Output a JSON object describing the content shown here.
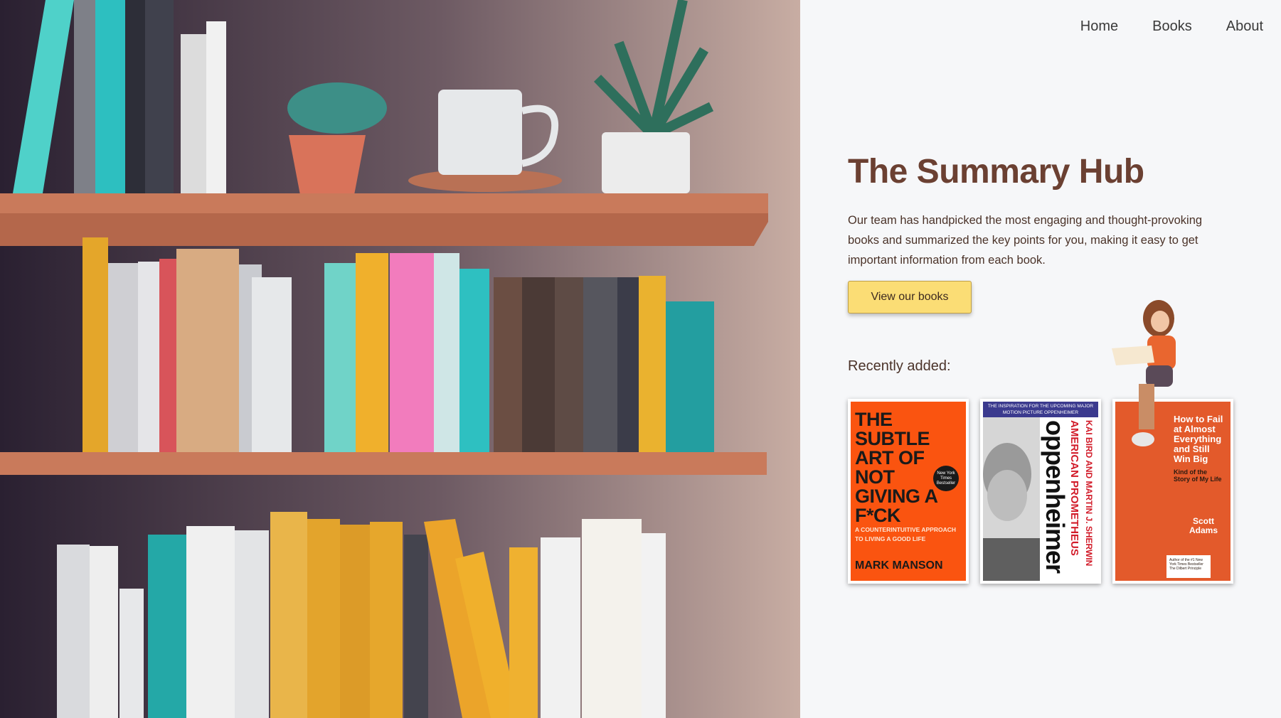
{
  "nav": {
    "home": "Home",
    "books": "Books",
    "about": "About"
  },
  "hero": {
    "title": "The Summary Hub",
    "description": "Our team has handpicked the most engaging and thought-provoking books and summarized the key points for you, making it easy to get important information from each book.",
    "cta_label": "View our books"
  },
  "recent": {
    "heading": "Recently added:",
    "books": [
      {
        "title_lines": "THE SUBTLE ART OF NOT GIVING A F*CK",
        "subtitle": "A COUNTERINTUITIVE APPROACH TO LIVING A GOOD LIFE",
        "author": "MARK MANSON",
        "badge": "New York Times Bestseller"
      },
      {
        "banner": "THE INSPIRATION FOR THE UPCOMING MAJOR MOTION PICTURE OPPENHEIMER",
        "title": "oppenheimer",
        "subtitle": "AMERICAN PROMETHEUS",
        "author": "KAI BIRD AND MARTIN J. SHERWIN"
      },
      {
        "title": "How to Fail at Almost Everything and Still Win Big",
        "subtitle": "Kind of the Story of My Life",
        "author": "Scott Adams",
        "box": "Author of the #1 New York Times Bestseller The Dilbert Principle"
      }
    ]
  },
  "colors": {
    "title": "#6b4032",
    "cta": "#fbdd75",
    "panel": "#f6f7f9"
  }
}
